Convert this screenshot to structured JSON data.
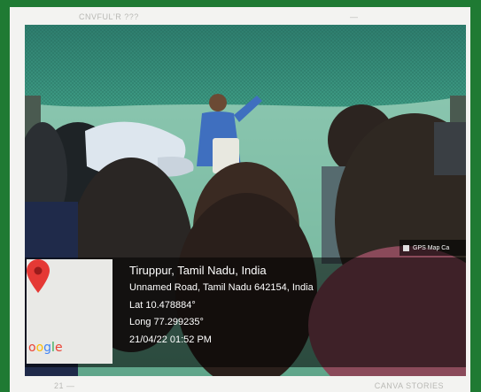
{
  "page_header": {
    "left": "CNVFUL'R ???",
    "right": "—"
  },
  "page_footer": {
    "left": "21 —",
    "right": "CANVA STORIES"
  },
  "gps_badge": {
    "label": "GPS Map Ca"
  },
  "location": {
    "title": "Tiruppur, Tamil Nadu, India",
    "address": "Unnamed Road, Tamil Nadu 642154, India",
    "lat": "Lat 10.478884°",
    "long": "Long 77.299235°",
    "datetime": "21/04/22 01:52 PM"
  },
  "map_thumbnail": {
    "logo_text": "oogle",
    "pin_icon": "map-pin-icon",
    "pin_color": "#e53935"
  },
  "colors": {
    "frame_green": "#1f7a33",
    "shade_net": "#2f8a7a"
  }
}
